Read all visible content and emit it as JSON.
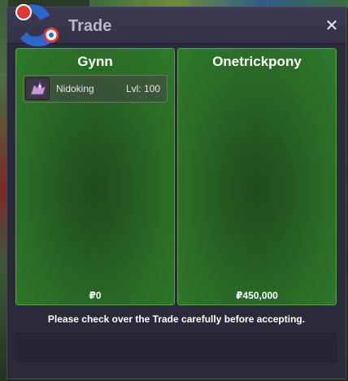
{
  "window": {
    "title": "Trade",
    "close_glyph": "✕"
  },
  "trade": {
    "left": {
      "player_name": "Gynn",
      "pokemon": [
        {
          "name": "Nidoking",
          "level": "Lvl: 100",
          "icon": "nidoking-sprite-icon"
        }
      ],
      "money": "₽0"
    },
    "right": {
      "player_name": "Onetrickpony",
      "pokemon": [],
      "money": "₽450,000"
    },
    "notice": "Please check over the Trade carefully before accepting."
  },
  "colors": {
    "panel_green": "#2a6a26",
    "panel_border": "#56a24e",
    "window_bg": "#2b2a3a",
    "title_text": "#b8b8c8"
  }
}
